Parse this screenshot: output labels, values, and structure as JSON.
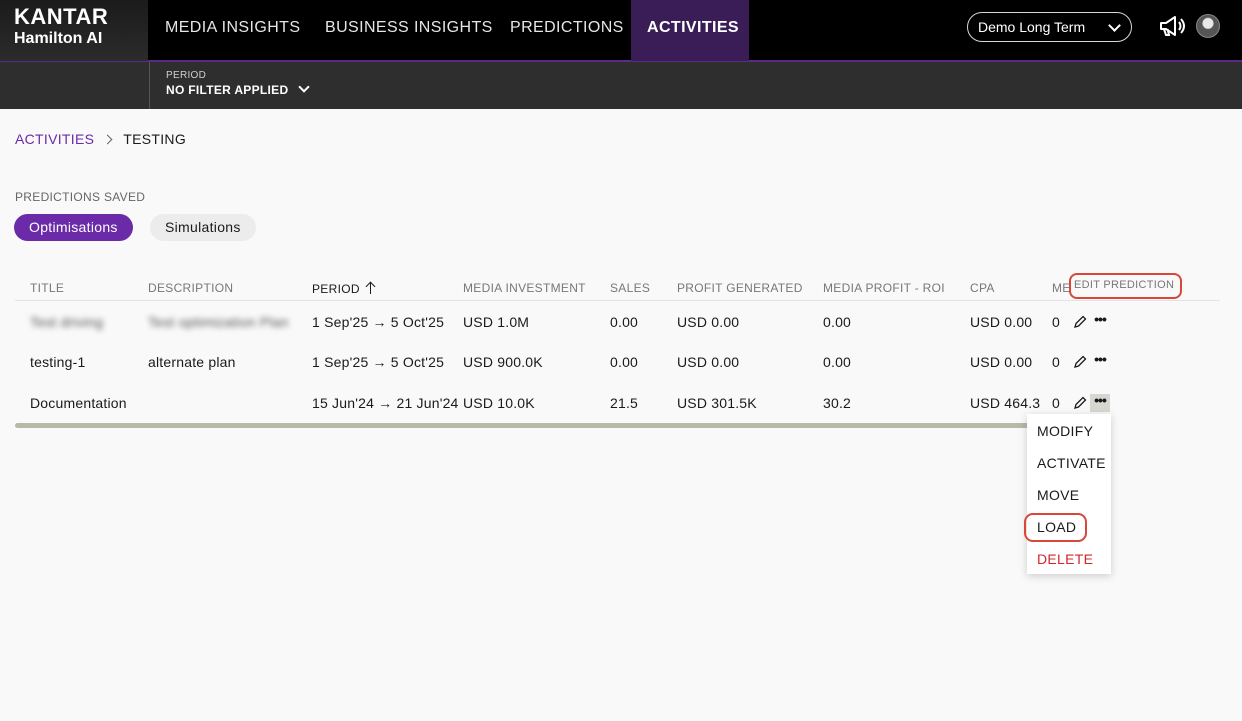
{
  "brand": {
    "line1": "KANTAR",
    "line2": "Hamilton AI"
  },
  "nav": {
    "tabs": [
      {
        "label": "MEDIA INSIGHTS"
      },
      {
        "label": "BUSINESS INSIGHTS"
      },
      {
        "label": "PREDICTIONS"
      },
      {
        "label": "ACTIVITIES",
        "active": true
      }
    ],
    "workspace": "Demo Long Term"
  },
  "filter": {
    "label": "PERIOD",
    "value": "NO FILTER APPLIED"
  },
  "breadcrumb": {
    "parent": "ACTIVITIES",
    "current": "TESTING"
  },
  "section_title": "PREDICTIONS SAVED",
  "toggle": {
    "active": "Optimisations",
    "inactive": "Simulations"
  },
  "table": {
    "columns": [
      "TITLE",
      "DESCRIPTION",
      "PERIOD",
      "MEDIA INVESTMENT",
      "SALES",
      "PROFIT GENERATED",
      "MEDIA PROFIT - ROI",
      "CPA",
      "ME"
    ],
    "edit_header": "EDIT PREDICTION",
    "rows": [
      {
        "title": "Test driving",
        "description": "Test optimization Plan",
        "period": "1 Sep'25 → 5 Oct'25",
        "media_investment": "USD 1.0M",
        "sales": "0.00",
        "profit": "USD 0.00",
        "roi": "0.00",
        "cpa": "USD 0.00",
        "me": "0"
      },
      {
        "title": "testing-1",
        "description": "alternate plan",
        "period": "1 Sep'25 → 5 Oct'25",
        "media_investment": "USD 900.0K",
        "sales": "0.00",
        "profit": "USD 0.00",
        "roi": "0.00",
        "cpa": "USD 0.00",
        "me": "0"
      },
      {
        "title": "Documentation",
        "description": "",
        "period": "15 Jun'24 → 21 Jun'24",
        "media_investment": "USD 10.0K",
        "sales": "21.5",
        "profit": "USD 301.5K",
        "roi": "30.2",
        "cpa": "USD 464.3",
        "me": "0"
      }
    ]
  },
  "menu": {
    "items": [
      "MODIFY",
      "ACTIVATE",
      "MOVE",
      "LOAD",
      "DELETE"
    ]
  },
  "colors": {
    "accent": "#6b2aa8",
    "highlight": "#d9473b",
    "danger": "#d0272c"
  }
}
